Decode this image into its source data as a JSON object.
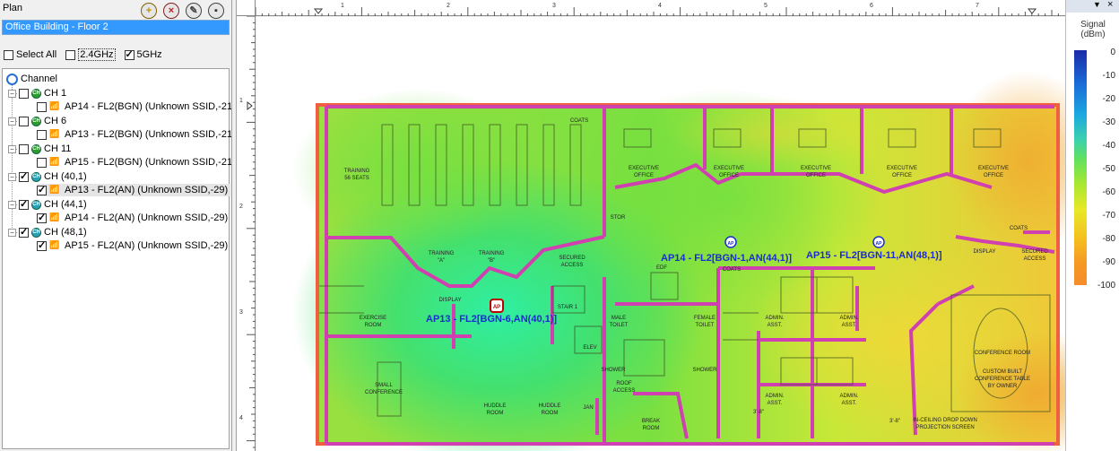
{
  "plan_panel": {
    "header": "Plan",
    "selected_plan": "Office Building - Floor 2",
    "toolbar": [
      "add-icon",
      "delete-icon",
      "edit-icon",
      "save-icon"
    ]
  },
  "filters": {
    "select_all": {
      "label": "Select All",
      "checked": false
    },
    "band24": {
      "label": "2.4GHz",
      "checked": false
    },
    "band5": {
      "label": "5GHz",
      "checked": true
    }
  },
  "tree": {
    "root": "Channel",
    "groups": [
      {
        "label": "CH 1",
        "checked": false,
        "ap": {
          "label": "AP14 - FL2(BGN) (Unknown SSID,-21)",
          "checked": false
        }
      },
      {
        "label": "CH 6",
        "checked": false,
        "ap": {
          "label": "AP13 - FL2(BGN) (Unknown SSID,-21)",
          "checked": false
        }
      },
      {
        "label": "CH 11",
        "checked": false,
        "ap": {
          "label": "AP15 - FL2(BGN) (Unknown SSID,-21)",
          "checked": false
        }
      },
      {
        "label": "CH (40,1)",
        "checked": true,
        "ap": {
          "label": "AP13 - FL2(AN) (Unknown SSID,-29)",
          "checked": true,
          "selected": true
        }
      },
      {
        "label": "CH (44,1)",
        "checked": true,
        "ap": {
          "label": "AP14 - FL2(AN) (Unknown SSID,-29)",
          "checked": true
        }
      },
      {
        "label": "CH (48,1)",
        "checked": true,
        "ap": {
          "label": "AP15 - FL2(AN) (Unknown SSID,-29)",
          "checked": true
        }
      }
    ]
  },
  "ruler": {
    "top_labels": [
      "1",
      "2",
      "3",
      "4",
      "5",
      "6",
      "7"
    ],
    "left_labels": [
      "1",
      "2",
      "3",
      "4"
    ]
  },
  "floor_plan": {
    "ap_labels": {
      "ap13": "AP13 - FL2[BGN-6,AN(40,1)]",
      "ap14": "AP14 - FL2[BGN-1,AN(44,1)]",
      "ap15": "AP15 - FL2[BGN-11,AN(48,1)]"
    },
    "ap_marker_text": "AP",
    "rooms": {
      "training": "TRAINING",
      "training_seats": "56 SEATS",
      "coats": "COATS",
      "exec": "EXECUTIVE",
      "office": "OFFICE",
      "stor": "STOR",
      "training_a": "TRAINING",
      "a": "\"A\"",
      "training_b": "TRAINING",
      "b": "\"B\"",
      "secured": "SECURED",
      "access": "ACCESS",
      "display": "DISPLAY",
      "exercise": "EXERCISE",
      "room": "ROOM",
      "small": "SMALL",
      "conference": "CONFERENCE",
      "huddle": "HUDDLE",
      "stair": "STAIR 1",
      "elev": "ELEV",
      "male_toilet": "MALE",
      "toilet": "TOILET",
      "female": "FEMALE",
      "edf": "EDF",
      "shower": "SHOWER",
      "roof_access": "ROOF",
      "break": "BREAK",
      "jan": "JAN",
      "admin": "ADMIN.",
      "asst": "ASST.",
      "conference_room": "CONFERENCE ROOM",
      "custom1": "CUSTOM BUILT",
      "custom2": "CONFERENCE TABLE",
      "custom3": "BY OWNER",
      "ceiling1": "IN-CEILING DROP DOWN",
      "ceiling2": "PROJECTION SCREEN",
      "dim1": "3'-8\"",
      "dim2": "3'-8\""
    }
  },
  "legend": {
    "title_line1": "Signal",
    "title_line2": "(dBm)",
    "ticks": [
      "0",
      "-10",
      "-20",
      "-30",
      "-40",
      "-50",
      "-60",
      "-70",
      "-80",
      "-90",
      "-100"
    ],
    "menu_icons": [
      "dropdown-icon",
      "close-icon"
    ]
  },
  "colors": {
    "selection": "#3399ff",
    "wall": "#d040b0",
    "ap_label": "#1a2ecc"
  }
}
